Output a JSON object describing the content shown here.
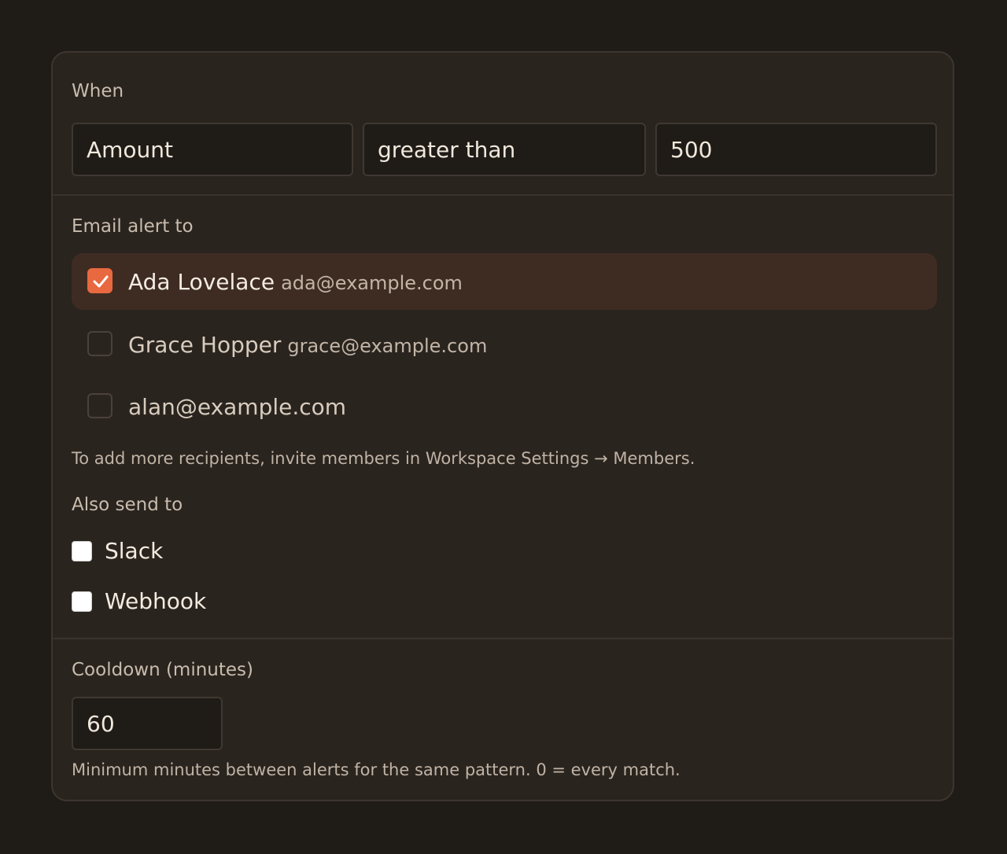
{
  "when": {
    "label": "When",
    "field": "Amount",
    "operator": "greater than",
    "value": "500"
  },
  "email": {
    "label": "Email alert to",
    "recipients": [
      {
        "name": "Ada Lovelace",
        "email": "ada@example.com",
        "checked": true
      },
      {
        "name": "Grace Hopper",
        "email": "grace@example.com",
        "checked": false
      },
      {
        "name": "alan@example.com",
        "email": "",
        "checked": false
      }
    ],
    "hint": "To add more recipients, invite members in Workspace Settings → Members."
  },
  "also": {
    "label": "Also send to",
    "channels": [
      {
        "label": "Slack",
        "checked": false
      },
      {
        "label": "Webhook",
        "checked": false
      }
    ]
  },
  "cooldown": {
    "label": "Cooldown (minutes)",
    "value": "60",
    "hint": "Minimum minutes between alerts for the same pattern. 0 = every match."
  },
  "colors": {
    "accent": "#e8693f",
    "selected_row": "#3e2c22",
    "panel": "#2a241f",
    "background": "#1f1b17"
  },
  "icons": {
    "check": "check-icon"
  }
}
